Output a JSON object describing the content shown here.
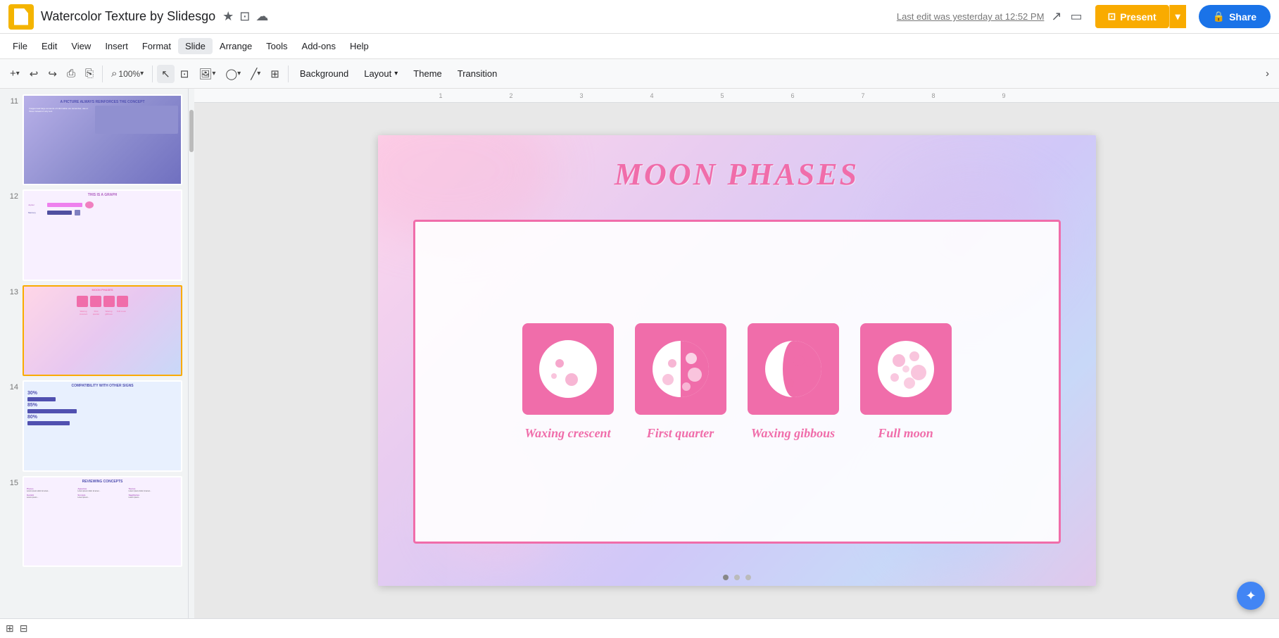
{
  "app": {
    "logo_alt": "Google Slides",
    "doc_title": "Watercolor Texture by Slidesgo",
    "last_edit": "Last edit was yesterday at 12:52 PM"
  },
  "topbar": {
    "star_icon": "★",
    "slides_icon": "⊡",
    "cloud_icon": "☁",
    "activity_icon": "↗",
    "comment_icon": "💬",
    "present_label": "Present",
    "share_label": "Share",
    "lock_icon": "🔒"
  },
  "menubar": {
    "items": [
      "File",
      "Edit",
      "View",
      "Insert",
      "Format",
      "Slide",
      "Arrange",
      "Tools",
      "Add-ons",
      "Help"
    ]
  },
  "toolbar": {
    "add_slide": "+",
    "undo": "↩",
    "redo": "↪",
    "print": "⎙",
    "paint": "⎘",
    "zoom_icon": "⌕",
    "zoom_value": "100%",
    "select": "↖",
    "select_shape": "⊡",
    "image": "🖼",
    "shape": "◯",
    "line": "╱",
    "text_box": "⊞",
    "background_label": "Background",
    "layout_label": "Layout",
    "layout_arrow": "▼",
    "theme_label": "Theme",
    "transition_label": "Transition"
  },
  "slides": [
    {
      "number": "11",
      "active": false,
      "title": "A PICTURE ALWAYS REINFORCES THE CONCEPT"
    },
    {
      "number": "12",
      "active": false,
      "title": "THIS IS A GRAPH"
    },
    {
      "number": "13",
      "active": true,
      "title": "MOON PHASES"
    },
    {
      "number": "14",
      "active": false,
      "title": "COMPATIBILITY WITH OTHER SIGNS"
    },
    {
      "number": "15",
      "active": false,
      "title": "REVIEWING CONCEPTS"
    }
  ],
  "slide_content": {
    "title": "MOON PHASES",
    "phases": [
      {
        "label": "Waxing crescent",
        "type": "waxing_crescent"
      },
      {
        "label": "First quarter",
        "type": "first_quarter"
      },
      {
        "label": "Waxing gibbous",
        "type": "waxing_gibbous"
      },
      {
        "label": "Full moon",
        "type": "full_moon"
      }
    ]
  },
  "colors": {
    "pink": "#f06daa",
    "accent": "#F9AB00",
    "blue": "#1a73e8"
  },
  "ruler": {
    "marks": [
      "1",
      "2",
      "3",
      "4",
      "5",
      "6",
      "7",
      "8",
      "9"
    ]
  },
  "bottom_bar": {
    "slide_indicator": "◼ ◻ ◻"
  }
}
